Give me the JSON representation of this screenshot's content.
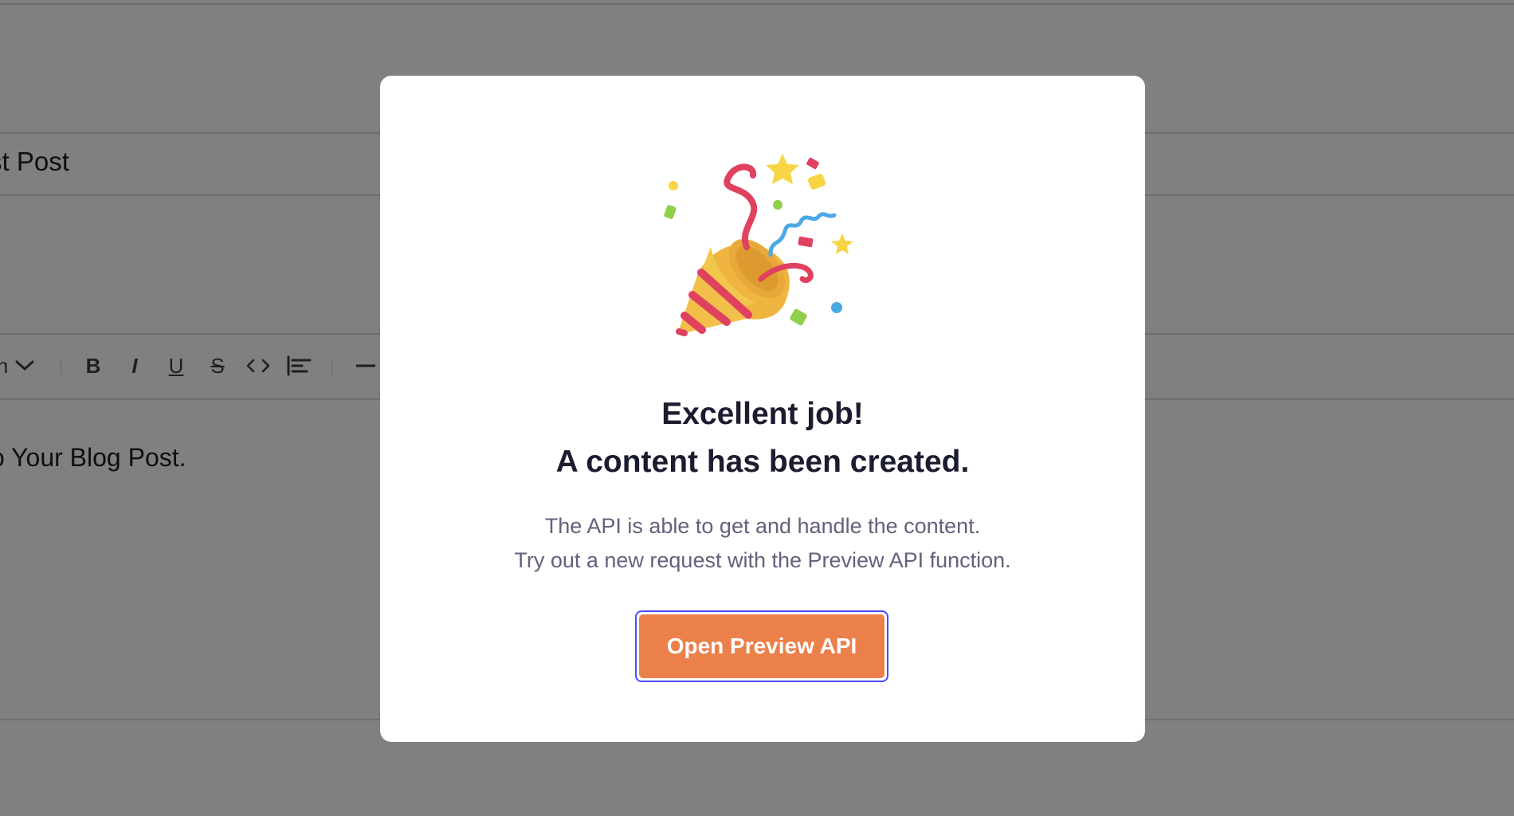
{
  "background": {
    "title_fragment": "st Post",
    "body_fragment": "o Your Blog Post.",
    "toolbar": {
      "items": [
        {
          "name": "heading-dropdown-chevron-icon",
          "glyph": "n"
        },
        {
          "name": "bold-icon",
          "glyph": "B"
        },
        {
          "name": "italic-icon",
          "glyph": "I"
        },
        {
          "name": "underline-icon",
          "glyph": "U"
        },
        {
          "name": "strikethrough-icon",
          "glyph": "S"
        },
        {
          "name": "code-icon",
          "glyph": "<>"
        },
        {
          "name": "align-left-icon",
          "glyph": ""
        },
        {
          "name": "horizontal-rule-icon",
          "glyph": "—"
        }
      ]
    }
  },
  "modal": {
    "icon": "party-popper-icon",
    "heading_line1": "Excellent job!",
    "heading_line2": "A content has been created.",
    "desc_line1": "The API is able to get and handle the content.",
    "desc_line2": "Try out a new request with the Preview API function.",
    "button_label": "Open Preview API"
  },
  "colors": {
    "overlay": "#808080",
    "modal_bg": "#ffffff",
    "heading": "#1c1c30",
    "description": "#62627e",
    "button_bg": "#ec804b",
    "button_text": "#ffffff",
    "focus_ring": "#4a4aff"
  }
}
